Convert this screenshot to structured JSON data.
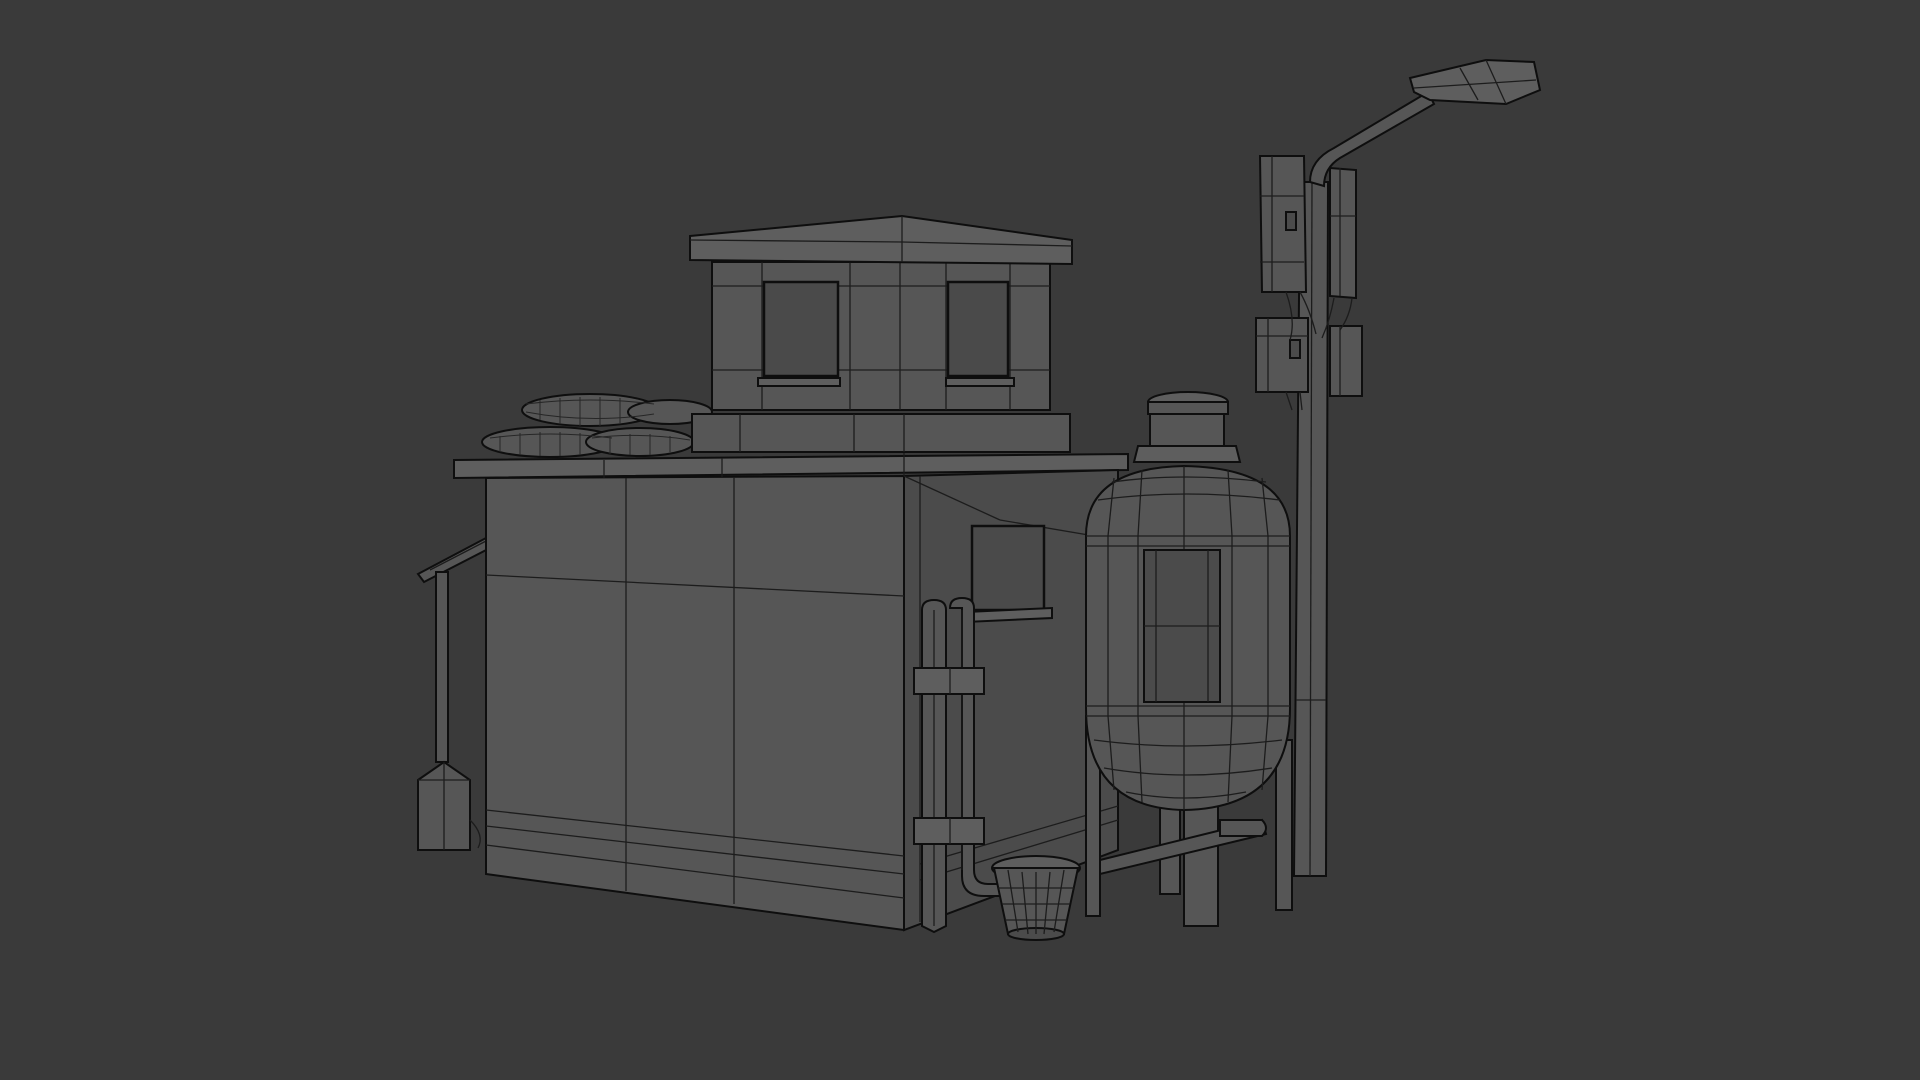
{
  "viewport": {
    "background": "#3a3a3a",
    "shading": "wireframe-on-shaded",
    "scene_objects": [
      "utility-building",
      "rooftop-booth",
      "sandbags",
      "side-canopy",
      "drain-pipes",
      "bucket",
      "water-tank",
      "street-lamp-pole",
      "electrical-boxes"
    ]
  }
}
